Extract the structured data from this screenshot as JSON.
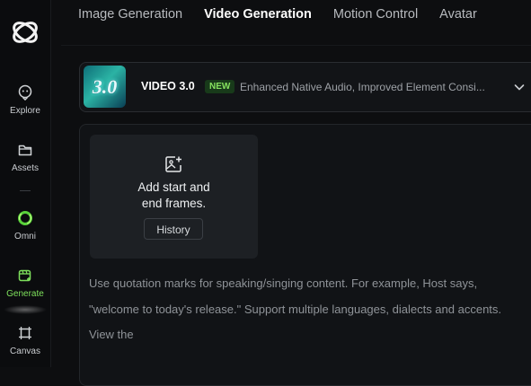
{
  "sidebar": {
    "items": [
      {
        "label": "Explore",
        "icon": "explore-icon"
      },
      {
        "label": "Assets",
        "icon": "folder-icon"
      },
      {
        "label": "Omni",
        "icon": "omni-ring-icon"
      },
      {
        "label": "Generate",
        "icon": "generate-icon",
        "active": true
      },
      {
        "label": "Canvas",
        "icon": "canvas-icon"
      }
    ]
  },
  "tabs": [
    {
      "label": "Image Generation"
    },
    {
      "label": "Video Generation",
      "active": true
    },
    {
      "label": "Motion Control"
    },
    {
      "label": "Avatar"
    }
  ],
  "model": {
    "thumb_text": "3.0",
    "name": "VIDEO 3.0",
    "badge": "NEW",
    "description": "Enhanced Native Audio, Improved Element Consi..."
  },
  "frames": {
    "line1": "Add start and",
    "line2": "end frames.",
    "history_label": "History"
  },
  "prompt": {
    "placeholder": "Use quotation marks for speaking/singing content. For example, Host says, \"welcome to today's release.\" Support multiple languages, dialects and accents. View the"
  },
  "colors": {
    "accent_green": "#7ee05c",
    "background": "#0d0e10",
    "panel": "#111316"
  }
}
